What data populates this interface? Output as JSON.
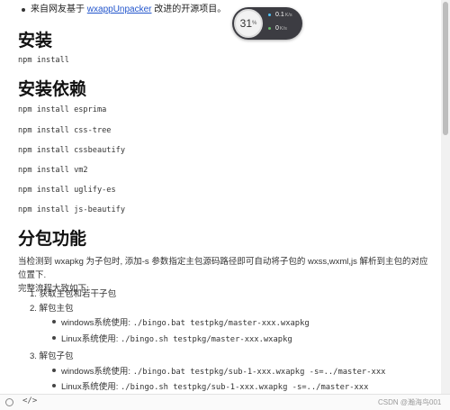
{
  "intro": {
    "text_before": "来自网友基于",
    "link": "wxappUnpacker",
    "text_after": "改进的开源项目。"
  },
  "install": {
    "heading": "安装",
    "command": "npm install"
  },
  "deps": {
    "heading": "安装依赖",
    "commands": [
      "npm install esprima",
      "npm install css-tree",
      "npm install cssbeautify",
      "npm install vm2",
      "npm install uglify-es",
      "npm install js-beautify"
    ]
  },
  "subpkg": {
    "heading": "分包功能",
    "para_line1": "当检测到 wxapkg 为子包时, 添加-s 参数指定主包源码路径即可自动将子包的 wxss,wxml,js 解析到主包的对应位置下.",
    "para_line2": "完整流程大致如下:",
    "steps": [
      "1. 获取主包和若干子包",
      "2. 解包主包",
      "3. 解包子包"
    ],
    "main_cmds": [
      {
        "label": "windows系统使用: ",
        "cmd": "./bingo.bat testpkg/master-xxx.wxapkg"
      },
      {
        "label": "Linux系统使用: ",
        "cmd": "./bingo.sh testpkg/master-xxx.wxapkg"
      }
    ],
    "sub_cmds": [
      {
        "label": "windows系统使用: ",
        "cmd": "./bingo.bat testpkg/sub-1-xxx.wxapkg -s=../master-xxx"
      },
      {
        "label": "Linux系统使用: ",
        "cmd": "./bingo.sh testpkg/sub-1-xxx.wxapkg -s=../master-xxx"
      }
    ]
  },
  "monitor": {
    "percent": "31",
    "percent_sign": "%",
    "upload": "0.1",
    "upload_unit": "K/s",
    "download": "0",
    "download_unit": "K/s",
    "upload_color": "#4fc3f7",
    "download_color": "#66bb6a"
  },
  "bottombar": {
    "code_icon_text": "</>",
    "watermark": "CSDN @瀚海鸟001"
  }
}
